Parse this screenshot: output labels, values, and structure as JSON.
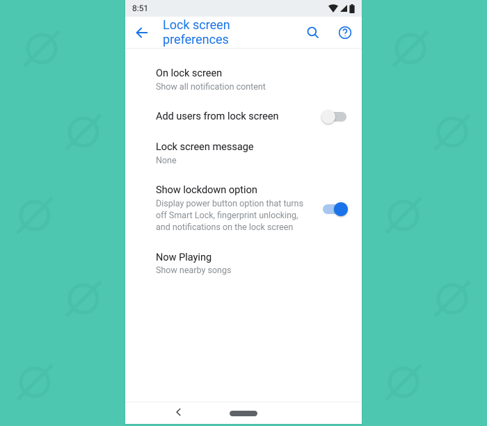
{
  "status": {
    "time": "8:51"
  },
  "header": {
    "title": "Lock screen preferences"
  },
  "settings": [
    {
      "title": "On lock screen",
      "subtitle": "Show all notification content",
      "has_switch": false
    },
    {
      "title": "Add users from lock screen",
      "subtitle": "",
      "has_switch": true,
      "switch_on": false
    },
    {
      "title": "Lock screen message",
      "subtitle": "None",
      "has_switch": false
    },
    {
      "title": "Show lockdown option",
      "subtitle": "Display power button option that turns off Smart Lock, fingerprint unlocking, and notifications on the lock screen",
      "has_switch": true,
      "switch_on": true
    },
    {
      "title": "Now Playing",
      "subtitle": "Show nearby songs",
      "has_switch": false
    }
  ]
}
